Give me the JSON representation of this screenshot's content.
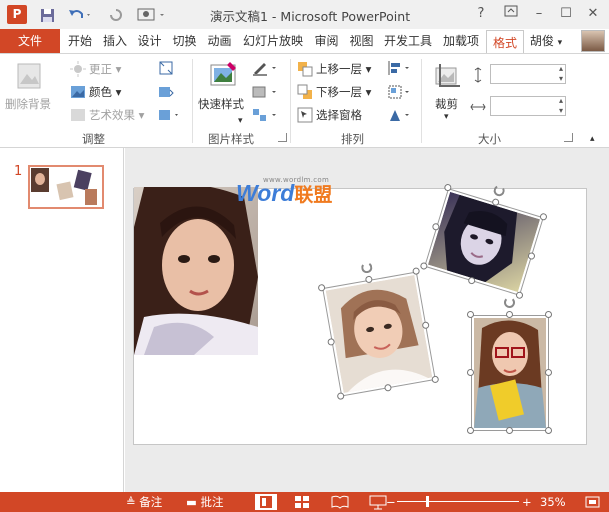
{
  "app": {
    "icon_letter": "P",
    "title": "演示文稿1 - Microsoft PowerPoint"
  },
  "window_controls": {
    "help": "?",
    "minimize": "–",
    "restore": "☐",
    "close": "✕"
  },
  "tabs": [
    {
      "label": "文件"
    },
    {
      "label": "开始"
    },
    {
      "label": "插入"
    },
    {
      "label": "设计"
    },
    {
      "label": "切换"
    },
    {
      "label": "动画"
    },
    {
      "label": "幻灯片放映"
    },
    {
      "label": "审阅"
    },
    {
      "label": "视图"
    },
    {
      "label": "开发工具"
    },
    {
      "label": "加载项"
    },
    {
      "label": "格式"
    }
  ],
  "user": {
    "name": "胡俊",
    "caret": "▾"
  },
  "ribbon": {
    "adjust": {
      "remove_bg": "删除背景",
      "corrections": "更正",
      "color": "颜色",
      "artistic": "艺术效果",
      "group_label": "调整"
    },
    "picture_styles": {
      "quick_styles": "快速样式",
      "group_label": "图片样式"
    },
    "arrange": {
      "bring_forward": "上移一层",
      "send_backward": "下移一层",
      "selection_pane": "选择窗格",
      "group_label": "排列"
    },
    "size": {
      "crop": "裁剪",
      "height_value": "",
      "width_value": "",
      "group_label": "大小"
    }
  },
  "thumbnails": [
    {
      "number": "1"
    }
  ],
  "watermark": {
    "url": "www.wordlm.com",
    "word": "Word",
    "brand": "联盟"
  },
  "status": {
    "notes": "备注",
    "comments": "批注",
    "zoom_minus": "−",
    "zoom_plus": "+",
    "zoom": "35%"
  },
  "colors": {
    "accent": "#d24726",
    "ribbon_bg": "#ffffff",
    "canvas_bg": "#ebebeb"
  }
}
